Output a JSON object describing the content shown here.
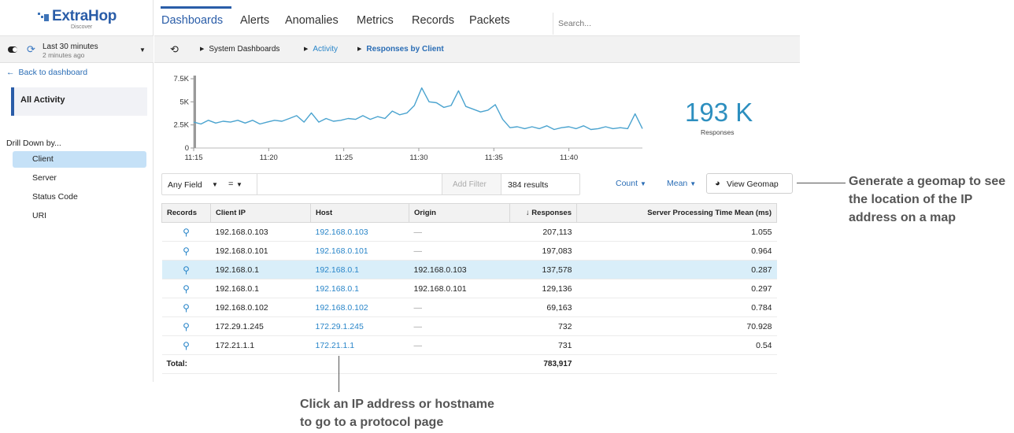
{
  "app": {
    "brand": "ExtraHop",
    "product": "Discover"
  },
  "timebar": {
    "range": "Last 30 minutes",
    "ago": "2 minutes ago"
  },
  "sidebar": {
    "back": "Back to dashboard",
    "all_activity": "All Activity",
    "drill_title": "Drill Down by...",
    "items": [
      {
        "label": "Client",
        "active": true
      },
      {
        "label": "Server"
      },
      {
        "label": "Status Code"
      },
      {
        "label": "URI"
      }
    ]
  },
  "nav": {
    "tabs": [
      "Dashboards",
      "Alerts",
      "Anomalies",
      "Metrics",
      "Records",
      "Packets"
    ],
    "active": "Dashboards",
    "search_placeholder": "Search..."
  },
  "breadcrumb": [
    "System Dashboards",
    "Activity",
    "Responses by Client"
  ],
  "kpi": {
    "value": "193 K",
    "label": "Responses"
  },
  "chart_data": {
    "type": "line",
    "x_ticks": [
      "11:15",
      "11:20",
      "11:25",
      "11:30",
      "11:35",
      "11:40"
    ],
    "y_ticks": [
      "0",
      "2.5K",
      "5K",
      "7.5K"
    ],
    "ylim": [
      0,
      7500
    ],
    "series": [
      {
        "values": [
          2800,
          2600,
          3000,
          2700,
          2900,
          2800,
          3000,
          2700,
          3000,
          2600,
          2800,
          3000,
          2900,
          3200,
          3500,
          2800,
          3800,
          2800,
          3200,
          2900,
          3000,
          3200,
          3100,
          3500,
          3100,
          3400,
          3200,
          4000,
          3600,
          3800,
          4600,
          6500,
          5000,
          4900,
          4400,
          4600,
          6200,
          4500,
          4200,
          3900,
          4100,
          4700,
          3100,
          2200,
          2300,
          2100,
          2300,
          2100,
          2400,
          2000,
          2200,
          2300,
          2100,
          2400,
          2000,
          2100,
          2300,
          2100,
          2200,
          2100,
          3700,
          2100
        ]
      }
    ],
    "grid": false
  },
  "filter": {
    "field": "Any Field",
    "operator": "=",
    "add_label": "Add Filter",
    "results": "384 results"
  },
  "controls": {
    "count": "Count",
    "mean": "Mean",
    "geomap": "View Geomap"
  },
  "table": {
    "headers": [
      "Records",
      "Client IP",
      "Host",
      "Origin",
      "↓ Responses",
      "Server Processing Time Mean (ms)"
    ],
    "rows": [
      {
        "client_ip": "192.168.0.103",
        "host": "192.168.0.103",
        "origin": "—",
        "responses": "207,113",
        "spt": "1.055"
      },
      {
        "client_ip": "192.168.0.101",
        "host": "192.168.0.101",
        "origin": "—",
        "responses": "197,083",
        "spt": "0.964"
      },
      {
        "client_ip": "192.168.0.1",
        "host": "192.168.0.1",
        "origin": "192.168.0.103",
        "responses": "137,578",
        "spt": "0.287"
      },
      {
        "client_ip": "192.168.0.1",
        "host": "192.168.0.1",
        "origin": "192.168.0.101",
        "responses": "129,136",
        "spt": "0.297"
      },
      {
        "client_ip": "192.168.0.102",
        "host": "192.168.0.102",
        "origin": "—",
        "responses": "69,163",
        "spt": "0.784"
      },
      {
        "client_ip": "172.29.1.245",
        "host": "172.29.1.245",
        "origin": "—",
        "responses": "732",
        "spt": "70.928"
      },
      {
        "client_ip": "172.21.1.1",
        "host": "172.21.1.1",
        "origin": "—",
        "responses": "731",
        "spt": "0.54"
      }
    ],
    "total_label": "Total:",
    "total_responses": "783,917"
  },
  "callouts": {
    "geomap": "Generate a geomap to see the location of the IP address on a map",
    "ip_line1": "Click an IP address or hostname",
    "ip_line2": "to go to a protocol page"
  }
}
